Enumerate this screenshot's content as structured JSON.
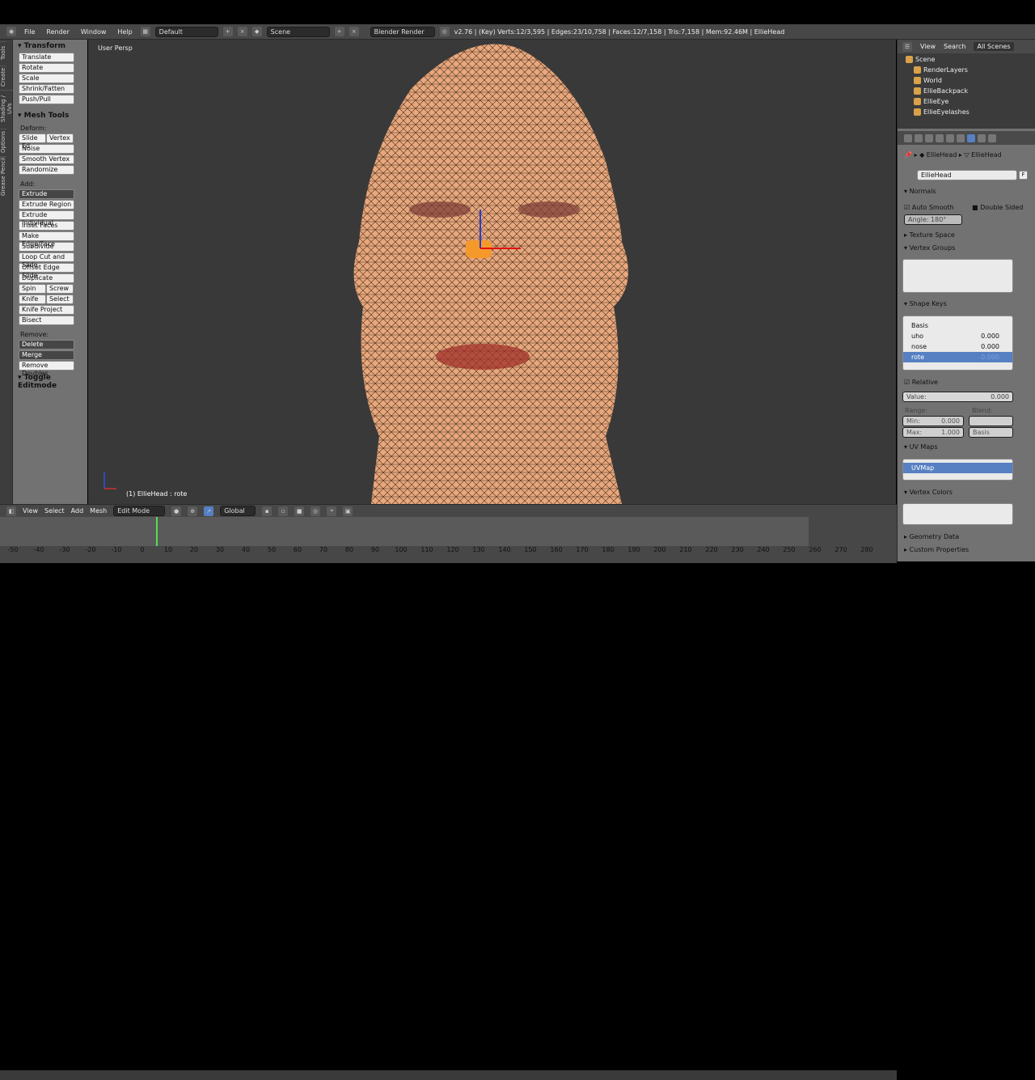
{
  "topbar": {
    "menus": [
      "File",
      "Render",
      "Window",
      "Help"
    ],
    "layout": "Default",
    "scene": "Scene",
    "engine": "Blender Render",
    "stats": "v2.76 | (Key) Verts:12/3,595 | Edges:23/10,758 | Faces:12/7,158 | Tris:7,158 | Mem:92.46M | EllieHead"
  },
  "left_tabs": [
    "Tools",
    "Create",
    "Shading / UVs",
    "Options",
    "Grease Pencil"
  ],
  "tool_panel": {
    "transform_header": "Transform",
    "transform": [
      "Translate",
      "Rotate",
      "Scale",
      "Shrink/Fatten",
      "Push/Pull"
    ],
    "mesh_tools_header": "Mesh Tools",
    "deform_label": "Deform:",
    "deform_pair": [
      "Slide Ed",
      "Vertex"
    ],
    "deform": [
      "Noise",
      "Smooth Vertex",
      "Randomize"
    ],
    "add_label": "Add:",
    "extrude": "Extrude",
    "add": [
      "Extrude Region",
      "Extrude Individual",
      "Inset Faces",
      "Make Edge/Face",
      "Subdivide",
      "Loop Cut and Slide",
      "Offset Edge Slide",
      "Duplicate"
    ],
    "spin_pair": [
      "Spin",
      "Screw"
    ],
    "knife_pair": [
      "Knife",
      "Select"
    ],
    "add_more": [
      "Knife Project",
      "Bisect"
    ],
    "remove_label": "Remove:",
    "delete": "Delete",
    "merge": "Merge",
    "remove_doubles": "Remove Doubles",
    "toggle_editmode": "Toggle Editmode"
  },
  "viewport": {
    "label": "User Persp",
    "object_label": "(1) EllieHead : rote"
  },
  "outliner": {
    "tabs": [
      "View",
      "Search",
      "All Scenes"
    ],
    "items": [
      "Scene",
      "RenderLayers",
      "World",
      "EllieBackpack",
      "EllieEye",
      "EllieEyelashes"
    ]
  },
  "properties": {
    "breadcrumb": [
      "EllieHead",
      "EllieHead"
    ],
    "mesh_name": "EllieHead",
    "fake_user": "F",
    "normals_header": "Normals",
    "auto_smooth": "Auto Smooth",
    "double_sided": "Double Sided",
    "angle": "Angle:",
    "angle_value": "180°",
    "texture_space": "Texture Space",
    "vertex_groups": "Vertex Groups",
    "shape_keys_header": "Shape Keys",
    "shape_keys": [
      {
        "name": "Basis",
        "value": ""
      },
      {
        "name": "uho",
        "value": "0.000"
      },
      {
        "name": "nose",
        "value": "0.000"
      },
      {
        "name": "rote",
        "value": "0.000"
      }
    ],
    "relative": "Relative",
    "value_label": "Value:",
    "value": "0.000",
    "range_label": "Range:",
    "blend_label": "Blend:",
    "min_label": "Min:",
    "min_value": "0.000",
    "max_label": "Max:",
    "max_value": "1.000",
    "blend_target": "Basis",
    "uv_maps_header": "UV Maps",
    "uv_map": "UVMap",
    "vertex_colors": "Vertex Colors",
    "geometry_data": "Geometry Data",
    "custom_properties": "Custom Properties"
  },
  "view_header": {
    "menus": [
      "View",
      "Select",
      "Add",
      "Mesh"
    ],
    "mode": "Edit Mode",
    "orientation": "Global"
  },
  "timeline": {
    "ticks": [
      "-50",
      "-40",
      "-30",
      "-20",
      "-10",
      "0",
      "10",
      "20",
      "30",
      "40",
      "50",
      "60",
      "70",
      "80",
      "90",
      "100",
      "110",
      "120",
      "130",
      "140",
      "150",
      "160",
      "170",
      "180",
      "190",
      "200",
      "210",
      "220",
      "230",
      "240",
      "250",
      "260",
      "270",
      "280"
    ]
  },
  "colors": {
    "accent": "#5680c2",
    "panel": "#727272",
    "viewport": "#393939",
    "header": "#474747",
    "skin": "#e8a77c"
  }
}
